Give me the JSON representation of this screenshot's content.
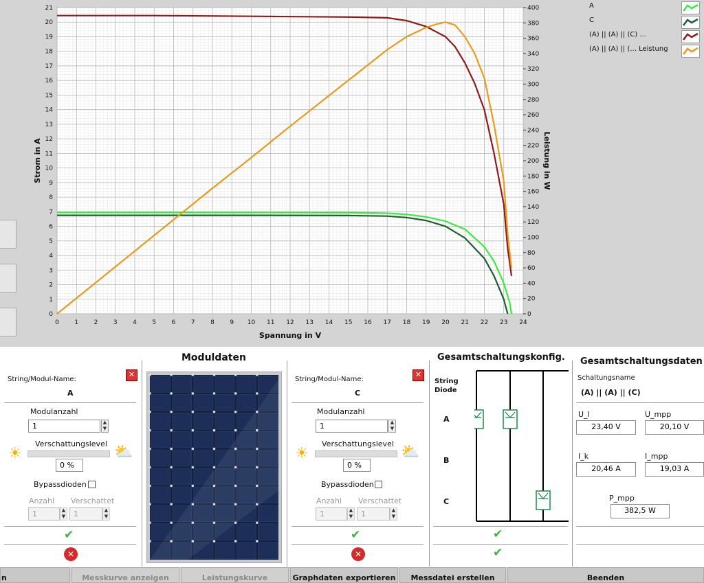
{
  "chart_data": {
    "type": "line",
    "xlabel": "Spannung in V",
    "ylabel": "Strom in A",
    "y2label": "Leistung in W",
    "xlim": [
      0,
      24
    ],
    "ylim": [
      0,
      21
    ],
    "y2lim": [
      0,
      400
    ],
    "x_ticks": [
      "0",
      "1",
      "2",
      "3",
      "4",
      "5",
      "6",
      "7",
      "8",
      "9",
      "10",
      "11",
      "12",
      "13",
      "14",
      "15",
      "16",
      "17",
      "18",
      "19",
      "20",
      "21",
      "22",
      "23",
      "24"
    ],
    "y_ticks": [
      "0",
      "1",
      "2",
      "3",
      "4",
      "5",
      "6",
      "7",
      "8",
      "9",
      "10",
      "11",
      "12",
      "13",
      "14",
      "15",
      "16",
      "17",
      "18",
      "19",
      "20",
      "21"
    ],
    "y2_ticks": [
      "0",
      "20",
      "40",
      "60",
      "80",
      "100",
      "120",
      "140",
      "160",
      "180",
      "200",
      "220",
      "240",
      "260",
      "280",
      "300",
      "320",
      "340",
      "360",
      "380",
      "400"
    ],
    "grid": true,
    "legend_position": "top-right",
    "series": [
      {
        "name": "A",
        "axis": "left",
        "color": "#3ee83e",
        "x": [
          0,
          5,
          10,
          15,
          17,
          18,
          19,
          20,
          21,
          22,
          22.5,
          23,
          23.3,
          23.4
        ],
        "y": [
          6.95,
          6.95,
          6.95,
          6.94,
          6.9,
          6.82,
          6.65,
          6.35,
          5.8,
          4.6,
          3.6,
          2.1,
          0.8,
          0
        ]
      },
      {
        "name": "C",
        "axis": "left",
        "color": "#1d5e30",
        "x": [
          0,
          5,
          10,
          15,
          17,
          18,
          19,
          20,
          21,
          22,
          22.5,
          23,
          23.2
        ],
        "y": [
          6.75,
          6.75,
          6.75,
          6.74,
          6.7,
          6.6,
          6.4,
          6.0,
          5.2,
          3.8,
          2.6,
          1.0,
          0
        ]
      },
      {
        "name": "(A) || (A) || (C) ...",
        "axis": "left",
        "color": "#8b1a1a",
        "x": [
          0,
          5,
          10,
          15,
          17,
          18,
          19,
          19.5,
          20,
          20.5,
          21,
          21.5,
          22,
          22.5,
          23,
          23.2,
          23.4
        ],
        "y": [
          20.45,
          20.45,
          20.4,
          20.35,
          20.3,
          20.1,
          19.7,
          19.35,
          19.0,
          18.3,
          17.2,
          15.8,
          14.0,
          11.0,
          7.5,
          4.5,
          2.6
        ]
      },
      {
        "name": "(A) || (A) || (... Leistung",
        "axis": "right",
        "color": "#e89a18",
        "x": [
          0,
          2,
          4,
          6,
          8,
          10,
          12,
          14,
          16,
          17,
          18,
          19,
          19.5,
          20,
          20.5,
          21,
          21.5,
          22,
          22.5,
          23,
          23.2,
          23.4
        ],
        "y": [
          0,
          41,
          82,
          123,
          164,
          204,
          245,
          285,
          325,
          345,
          362,
          374,
          378,
          381,
          377,
          362,
          340,
          308,
          247,
          173,
          104,
          60
        ]
      }
    ]
  },
  "left_panel_a": {
    "name_label": "String/Modul-Name:",
    "name_value": "A",
    "modulanzahl_label": "Modulanzahl",
    "modulanzahl_value": "1",
    "verschattung_label": "Verschattungslevel",
    "verschattung_value": "0 %",
    "bypass_label": "Bypassdioden",
    "anzahl_label": "Anzahl",
    "verschattet_label": "Verschattet",
    "anzahl_value": "1",
    "verschattet_value": "1"
  },
  "moduldaten_title": "Moduldaten",
  "left_panel_c": {
    "name_label": "String/Modul-Name:",
    "name_value": "C",
    "modulanzahl_label": "Modulanzahl",
    "modulanzahl_value": "1",
    "verschattung_label": "Verschattungslevel",
    "verschattung_value": "0 %",
    "bypass_label": "Bypassdioden",
    "anzahl_label": "Anzahl",
    "verschattet_label": "Verschattet",
    "anzahl_value": "1",
    "verschattet_value": "1"
  },
  "konfig": {
    "title": "Gesamtschaltungskonfig.",
    "col_label_1": "String",
    "col_label_2": "Diode",
    "rows": [
      "A",
      "B",
      "C"
    ]
  },
  "daten": {
    "title": "Gesamtschaltungsdaten",
    "schaltungsname_label": "Schaltungsname",
    "schaltungsname_value": "(A) || (A) || (C)",
    "ul_label": "U_l",
    "ul_value": "23,40 V",
    "umpp_label": "U_mpp",
    "umpp_value": "20,10 V",
    "ik_label": "I_k",
    "ik_value": "20,46 A",
    "impp_label": "I_mpp",
    "impp_value": "19,03 A",
    "pmpp_label": "P_mpp",
    "pmpp_value": "382,5 W"
  },
  "toolbar": {
    "btn0": "n",
    "btn1": "Messkurve anzeigen",
    "btn2": "Leistungskurve anzeigen",
    "btn3": "Graphdaten exportieren",
    "btn4": "Messdatei erstellen",
    "btn5": "Beenden"
  }
}
